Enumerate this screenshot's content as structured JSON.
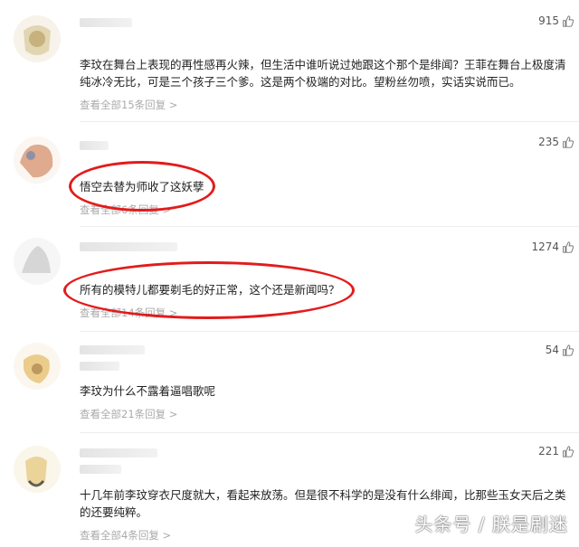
{
  "comments": [
    {
      "likes": "915",
      "text": "李玟在舞台上表现的再性感再火辣，但生活中谁听说过她跟这个那个是绯闻？王菲在舞台上极度清纯冰冷无比，可是三个孩子三个爹。这是两个极端的对比。望粉丝勿喷，实话实说而已。",
      "replies": "查看全部15条回复 >"
    },
    {
      "likes": "235",
      "text": "悟空去替为师收了这妖孽",
      "replies": "查看全部6条回复 >"
    },
    {
      "likes": "1274",
      "text": "所有的模特儿都要剃毛的好正常，这个还是新闻吗？",
      "replies": "查看全部14条回复 >"
    },
    {
      "likes": "54",
      "text": "李玟为什么不露着逼唱歌呢",
      "replies": "查看全部21条回复 >"
    },
    {
      "likes": "221",
      "text": "十几年前李玟穿衣尺度就大，看起来放荡。但是很不科学的是没有什么绯闻，比那些玉女天后之类的还要纯粹。",
      "replies": "查看全部4条回复 >"
    }
  ],
  "watermark": "头条号 / 朕是剧迷",
  "colors": {
    "highlight": "#e31b1b",
    "reply_link": "#aaaaaa"
  },
  "icons": {
    "like": "thumbs-up-icon"
  }
}
